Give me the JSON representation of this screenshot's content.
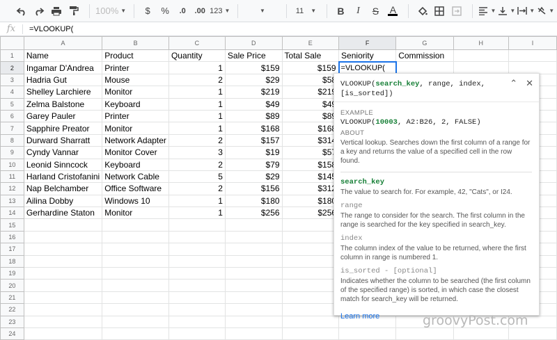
{
  "toolbar": {
    "zoom": "100%",
    "currency": "$",
    "percent": "%",
    "decrease_decimal": ".0",
    "increase_decimal": ".00",
    "number_format": "123",
    "font_size": "11",
    "bold": "B",
    "italic": "I",
    "strike": "S",
    "text_color": "A"
  },
  "formula_bar": {
    "fx": "fx",
    "value": "=VLOOKUP("
  },
  "columns": [
    "A",
    "B",
    "C",
    "D",
    "E",
    "F",
    "G",
    "H",
    "I"
  ],
  "rows": [
    {
      "n": "1",
      "cells": [
        "Name",
        "Product",
        "Quantity",
        "Sale Price",
        "Total Sale",
        "Seniority",
        "Commission",
        "",
        ""
      ]
    },
    {
      "n": "2",
      "cells": [
        "Ingamar D'Andrea",
        "Printer",
        "1",
        "$159",
        "$159",
        "=VLOOKUP(",
        "",
        "",
        ""
      ]
    },
    {
      "n": "3",
      "cells": [
        "Hadria Gut",
        "Mouse",
        "2",
        "$29",
        "$58",
        "",
        "",
        "",
        ""
      ]
    },
    {
      "n": "4",
      "cells": [
        "Shelley Larchiere",
        "Monitor",
        "1",
        "$219",
        "$219",
        "",
        "",
        "",
        ""
      ]
    },
    {
      "n": "5",
      "cells": [
        "Zelma Balstone",
        "Keyboard",
        "1",
        "$49",
        "$49",
        "",
        "",
        "",
        ""
      ]
    },
    {
      "n": "6",
      "cells": [
        "Garey Pauler",
        "Printer",
        "1",
        "$89",
        "$89",
        "",
        "",
        "",
        ""
      ]
    },
    {
      "n": "7",
      "cells": [
        "Sapphire Preator",
        "Monitor",
        "1",
        "$168",
        "$168",
        "",
        "",
        "",
        ""
      ]
    },
    {
      "n": "8",
      "cells": [
        "Durward Sharratt",
        "Network Adapter",
        "2",
        "$157",
        "$314",
        "",
        "",
        "",
        ""
      ]
    },
    {
      "n": "9",
      "cells": [
        "Cyndy Vannar",
        "Monitor Cover",
        "3",
        "$19",
        "$57",
        "",
        "",
        "",
        ""
      ]
    },
    {
      "n": "10",
      "cells": [
        "Leonid Sinncock",
        "Keyboard",
        "2",
        "$79",
        "$158",
        "",
        "",
        "",
        ""
      ]
    },
    {
      "n": "11",
      "cells": [
        "Harland Cristofanini",
        "Network Cable",
        "5",
        "$29",
        "$145",
        "",
        "",
        "",
        ""
      ]
    },
    {
      "n": "12",
      "cells": [
        "Nap Belchamber",
        "Office Software",
        "2",
        "$156",
        "$312",
        "",
        "",
        "",
        ""
      ]
    },
    {
      "n": "13",
      "cells": [
        "Ailina Dobby",
        "Windows 10",
        "1",
        "$180",
        "$180",
        "",
        "",
        "",
        ""
      ]
    },
    {
      "n": "14",
      "cells": [
        "Gerhardine Staton",
        "Monitor",
        "1",
        "$256",
        "$256",
        "",
        "",
        "",
        ""
      ]
    },
    {
      "n": "15",
      "cells": [
        "",
        "",
        "",
        "",
        "",
        "",
        "",
        "",
        ""
      ]
    },
    {
      "n": "16",
      "cells": [
        "",
        "",
        "",
        "",
        "",
        "",
        "",
        "",
        ""
      ]
    },
    {
      "n": "17",
      "cells": [
        "",
        "",
        "",
        "",
        "",
        "",
        "",
        "",
        ""
      ]
    },
    {
      "n": "18",
      "cells": [
        "",
        "",
        "",
        "",
        "",
        "",
        "",
        "",
        ""
      ]
    },
    {
      "n": "19",
      "cells": [
        "",
        "",
        "",
        "",
        "",
        "",
        "",
        "",
        ""
      ]
    },
    {
      "n": "20",
      "cells": [
        "",
        "",
        "",
        "",
        "",
        "",
        "",
        "",
        ""
      ]
    },
    {
      "n": "21",
      "cells": [
        "",
        "",
        "",
        "",
        "",
        "",
        "",
        "",
        ""
      ]
    },
    {
      "n": "22",
      "cells": [
        "",
        "",
        "",
        "",
        "",
        "",
        "",
        "",
        ""
      ]
    },
    {
      "n": "23",
      "cells": [
        "",
        "",
        "",
        "",
        "",
        "",
        "",
        "",
        ""
      ]
    },
    {
      "n": "24",
      "cells": [
        "",
        "",
        "",
        "",
        "",
        "",
        "",
        "",
        ""
      ]
    }
  ],
  "tooltip": {
    "sig_fn": "VLOOKUP(",
    "sig_arg1": "search_key",
    "sig_rest": ", range, index,",
    "sig_line2": "[is_sorted])",
    "example_label": "EXAMPLE",
    "example_fn": "VLOOKUP(",
    "example_key": "10003",
    "example_rest": ", A2:B26, 2, FALSE)",
    "about_label": "ABOUT",
    "about_text": "Vertical lookup. Searches down the first column of a range for a key and returns the value of a specified cell in the row found.",
    "args": [
      {
        "name": "search_key",
        "desc": "The value to search for. For example, 42, \"Cats\", or I24."
      },
      {
        "name": "range",
        "desc": "The range to consider for the search. The first column in the range is searched for the key specified in search_key."
      },
      {
        "name": "index",
        "desc": "The column index of the value to be returned, where the first column in range is numbered 1."
      },
      {
        "name": "is_sorted - [optional]",
        "desc": "Indicates whether the column to be searched (the first column of the specified range) is sorted, in which case the closest match for search_key will be returned."
      }
    ],
    "learn_more": "Learn more"
  },
  "watermark": "groovyPost.com"
}
